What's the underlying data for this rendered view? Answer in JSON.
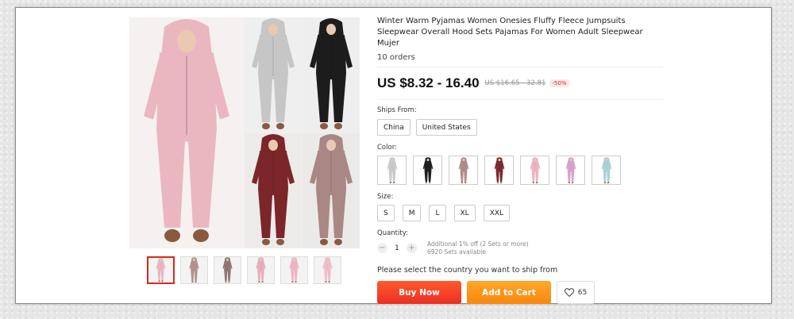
{
  "product": {
    "title": "Winter Warm Pyjamas Women Onesies Fluffy Fleece Jumpsuits Sleepwear Overall Hood Sets Pajamas For Women Adult Sleepwear Mujer",
    "orders": "10 orders"
  },
  "price": {
    "current": "US $8.32 - 16.40",
    "original": "US $16.65 - 32.81",
    "discount": "-50%"
  },
  "ships_from": {
    "label": "Ships From:",
    "options": [
      "China",
      "United States"
    ]
  },
  "color": {
    "label": "Color:",
    "swatches": [
      "#c9c9c9",
      "#1f1f1f",
      "#b08c89",
      "#7a2a2e",
      "#e9b4c0",
      "#d6a4cb",
      "#a9cfd8"
    ]
  },
  "size": {
    "label": "Size:",
    "options": [
      "S",
      "M",
      "L",
      "XL",
      "XXL"
    ]
  },
  "quantity": {
    "label": "Quantity:",
    "value": "1",
    "minus": "−",
    "plus": "+",
    "note_offer": "Additional 1% off (2 Sets or more)",
    "note_stock": "6920 Sets available"
  },
  "shipping_message": "Please select the country you want to ship from",
  "buttons": {
    "buy_now": "Buy Now",
    "add_to_cart": "Add to Cart",
    "wishlist_count": "65"
  },
  "gallery": {
    "main_colors": [
      "#eab7c0",
      "#c6c6c6",
      "#1c1c1c",
      "#7b2629",
      "#a88784"
    ],
    "thumb_colors": [
      "#e9b5c0",
      "#b3918d",
      "#8e7674",
      "#e7adbb",
      "#efb5c4",
      "#f0bccb"
    ],
    "active_thumb": 0
  },
  "icons": {
    "wishlist": "heart-icon"
  }
}
